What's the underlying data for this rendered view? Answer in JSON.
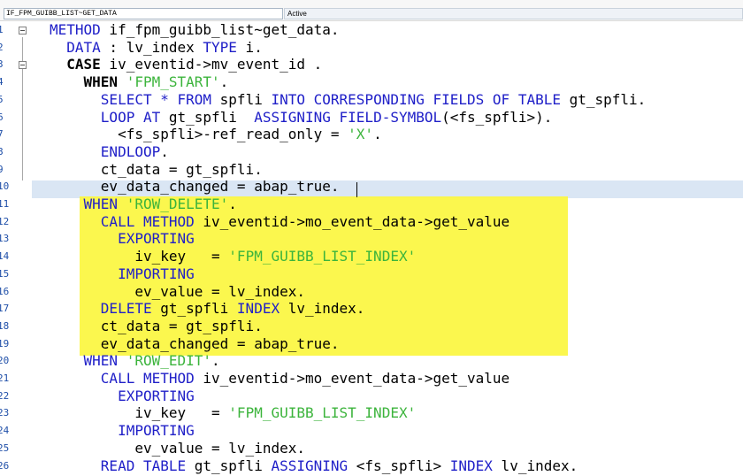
{
  "titlebar": {
    "object_name": "IF_FPM_GUIBB_LIST~GET_DATA",
    "status": "Active"
  },
  "colors": {
    "keyword": "#2020c8",
    "string": "#3cb43c",
    "highlight": "#fbf744",
    "current_line": "#dae6f4"
  },
  "editor": {
    "line_numbers": [
      "1",
      "2",
      "3",
      "4",
      "5",
      "6",
      "7",
      "8",
      "9",
      "10",
      "11",
      "12",
      "13",
      "14",
      "15",
      "16",
      "17",
      "18",
      "19",
      "20",
      "21",
      "22",
      "23",
      "24",
      "25",
      "26"
    ],
    "lines": [
      [
        {
          "t": "METHOD",
          "c": "kw"
        },
        {
          "t": " if_fpm_guibb_list~get_data.",
          "c": ""
        }
      ],
      [
        {
          "t": "  DATA",
          "c": "kw"
        },
        {
          "t": " : lv_index ",
          "c": ""
        },
        {
          "t": "TYPE",
          "c": "kw"
        },
        {
          "t": " i.",
          "c": ""
        }
      ],
      [
        {
          "t": "  CASE",
          "c": "kwb"
        },
        {
          "t": " iv_eventid->mv_event_id .",
          "c": ""
        }
      ],
      [
        {
          "t": "    WHEN",
          "c": "kwb"
        },
        {
          "t": " ",
          "c": ""
        },
        {
          "t": "'FPM_START'",
          "c": "str"
        },
        {
          "t": ".",
          "c": ""
        }
      ],
      [
        {
          "t": "      SELECT",
          "c": "kw"
        },
        {
          "t": " * ",
          "c": "kw"
        },
        {
          "t": "FROM",
          "c": "kw"
        },
        {
          "t": " spfli ",
          "c": ""
        },
        {
          "t": "INTO CORRESPONDING FIELDS OF TABLE",
          "c": "kw"
        },
        {
          "t": " gt_spfli.",
          "c": ""
        }
      ],
      [
        {
          "t": "      LOOP AT",
          "c": "kw"
        },
        {
          "t": " gt_spfli  ",
          "c": ""
        },
        {
          "t": "ASSIGNING FIELD-SYMBOL",
          "c": "kw"
        },
        {
          "t": "(<fs_spfli>).",
          "c": ""
        }
      ],
      [
        {
          "t": "        <fs_spfli>-ref_read_only = ",
          "c": ""
        },
        {
          "t": "'X'",
          "c": "str"
        },
        {
          "t": ".",
          "c": ""
        }
      ],
      [
        {
          "t": "      ENDLOOP",
          "c": "kw"
        },
        {
          "t": ".",
          "c": ""
        }
      ],
      [
        {
          "t": "      ct_data = gt_spfli.",
          "c": ""
        }
      ],
      [
        {
          "t": "      ev_data_changed = abap_true.",
          "c": ""
        }
      ],
      [
        {
          "t": "    WHEN",
          "c": "kw"
        },
        {
          "t": " ",
          "c": ""
        },
        {
          "t": "'ROW_DELETE'",
          "c": "str"
        },
        {
          "t": ".",
          "c": ""
        }
      ],
      [
        {
          "t": "      CALL METHOD",
          "c": "kw"
        },
        {
          "t": " iv_eventid->mo_event_data->get_value",
          "c": ""
        }
      ],
      [
        {
          "t": "        EXPORTING",
          "c": "kw"
        }
      ],
      [
        {
          "t": "          iv_key   = ",
          "c": ""
        },
        {
          "t": "'FPM_GUIBB_LIST_INDEX'",
          "c": "str"
        }
      ],
      [
        {
          "t": "        IMPORTING",
          "c": "kw"
        }
      ],
      [
        {
          "t": "          ev_value = lv_index.",
          "c": ""
        }
      ],
      [
        {
          "t": "      DELETE",
          "c": "kw"
        },
        {
          "t": " gt_spfli ",
          "c": ""
        },
        {
          "t": "INDEX",
          "c": "kw"
        },
        {
          "t": " lv_index.",
          "c": ""
        }
      ],
      [
        {
          "t": "      ct_data = gt_spfli.",
          "c": ""
        }
      ],
      [
        {
          "t": "      ev_data_changed = abap_true.",
          "c": ""
        }
      ],
      [
        {
          "t": "    WHEN",
          "c": "kw"
        },
        {
          "t": " ",
          "c": ""
        },
        {
          "t": "'ROW_EDIT'",
          "c": "str"
        },
        {
          "t": ".",
          "c": ""
        }
      ],
      [
        {
          "t": "      CALL METHOD",
          "c": "kw"
        },
        {
          "t": " iv_eventid->mo_event_data->get_value",
          "c": ""
        }
      ],
      [
        {
          "t": "        EXPORTING",
          "c": "kw"
        }
      ],
      [
        {
          "t": "          iv_key   = ",
          "c": ""
        },
        {
          "t": "'FPM_GUIBB_LIST_INDEX'",
          "c": "str"
        }
      ],
      [
        {
          "t": "        IMPORTING",
          "c": "kw"
        }
      ],
      [
        {
          "t": "          ev_value = lv_index.",
          "c": ""
        }
      ],
      [
        {
          "t": "      READ TABLE",
          "c": "kw"
        },
        {
          "t": " gt_spfli ",
          "c": ""
        },
        {
          "t": "ASSIGNING",
          "c": "kw"
        },
        {
          "t": " <fs_spfli> ",
          "c": ""
        },
        {
          "t": "INDEX",
          "c": "kw"
        },
        {
          "t": " lv_index.",
          "c": ""
        }
      ]
    ]
  }
}
